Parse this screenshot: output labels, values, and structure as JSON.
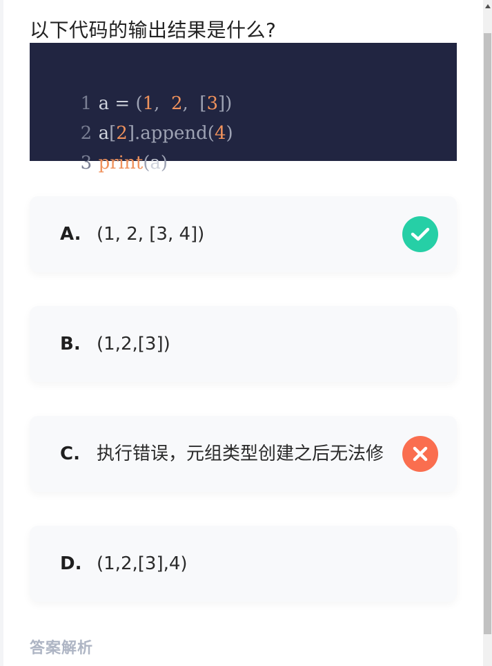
{
  "question": {
    "title": "以下代码的输出结果是什么?"
  },
  "code": {
    "lines": [
      {
        "no": "1",
        "tokens": [
          {
            "t": "a",
            "c": "id"
          },
          {
            "t": " = ",
            "c": "id"
          },
          {
            "t": "(",
            "c": "punc"
          },
          {
            "t": "1",
            "c": "num"
          },
          {
            "t": ",  ",
            "c": "punc"
          },
          {
            "t": "2",
            "c": "num"
          },
          {
            "t": ",  ",
            "c": "punc"
          },
          {
            "t": "[",
            "c": "punc"
          },
          {
            "t": "3",
            "c": "num"
          },
          {
            "t": "])",
            "c": "punc"
          }
        ]
      },
      {
        "no": "2",
        "tokens": [
          {
            "t": "a",
            "c": "id"
          },
          {
            "t": "[",
            "c": "punc"
          },
          {
            "t": "2",
            "c": "num"
          },
          {
            "t": "].append(",
            "c": "punc"
          },
          {
            "t": "4",
            "c": "num"
          },
          {
            "t": ")",
            "c": "punc"
          }
        ]
      },
      {
        "no": "3",
        "tokens": [
          {
            "t": "print",
            "c": "kw"
          },
          {
            "t": "(",
            "c": "punc"
          },
          {
            "t": "a",
            "c": "id"
          },
          {
            "t": ")",
            "c": "punc"
          }
        ]
      }
    ]
  },
  "options": [
    {
      "letter": "A.",
      "text": "(1, 2, [3, 4])",
      "status": "correct",
      "icon": "check-circle-icon"
    },
    {
      "letter": "B.",
      "text": "(1,2,[3])",
      "status": "none"
    },
    {
      "letter": "C.",
      "text": "执行错误，元组类型创建之后无法修",
      "status": "wrong",
      "icon": "x-circle-icon"
    },
    {
      "letter": "D.",
      "text": "(1,2,[3],4)",
      "status": "none"
    }
  ],
  "analysis": {
    "label": "答案解析"
  },
  "colors": {
    "code_background": "#212541",
    "correct": "#26cfa6",
    "wrong": "#fa6e4f",
    "analysis_label": "#aeb5c4"
  }
}
